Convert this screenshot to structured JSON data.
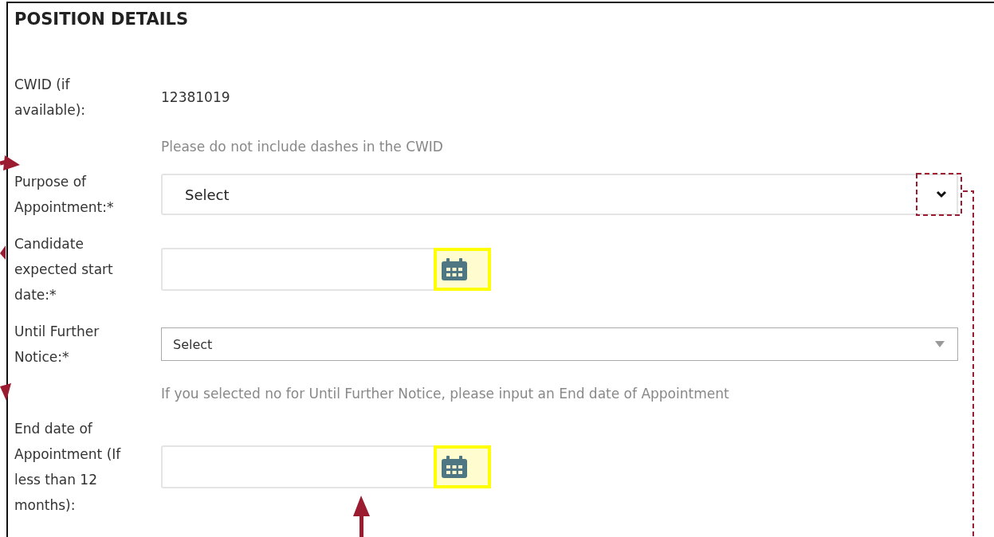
{
  "section_title": "POSITION DETAILS",
  "fields": [
    {
      "kind": "value",
      "label": "CWID (if available):",
      "value": "12381019",
      "hint": "Please do not include dashes in the CWID"
    },
    {
      "kind": "select",
      "label": "Purpose of Appointment:*",
      "value": "Select"
    },
    {
      "kind": "date",
      "label": "Candidate expected start date:*"
    },
    {
      "kind": "dropdown",
      "label": "Until Further Notice:*",
      "value": "Select",
      "hint": "If you selected no for Until Further Notice, please input an End date of Appointment"
    },
    {
      "kind": "date",
      "label": "End date of Appointment (If less than 12 months):"
    }
  ]
}
